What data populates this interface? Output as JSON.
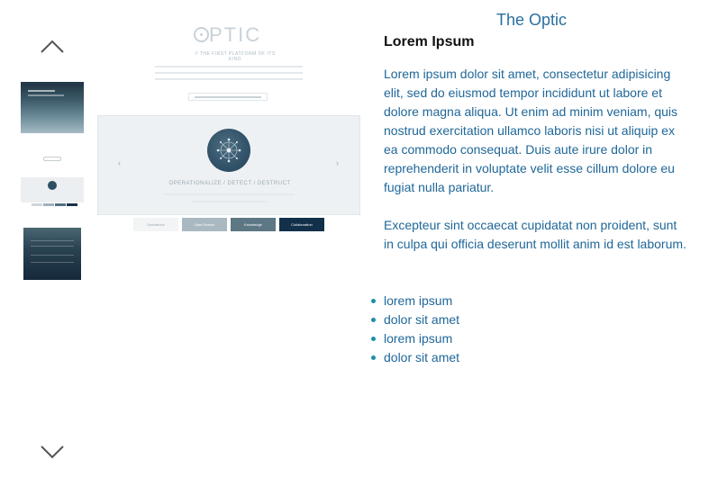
{
  "preview": {
    "logo_text": "PTIC",
    "tagline": "// THE FIRST PLATFORM OF ITS KIND",
    "panel_title": "OPERATIONALIZE / DETECT / DESTRUCT",
    "tabs": [
      {
        "label": "Operations",
        "color": "#f2f4f5"
      },
      {
        "label": "Data Search",
        "color": "#a9b8c1"
      },
      {
        "label": "Knowledge",
        "color": "#5d7785"
      },
      {
        "label": "Collaboration",
        "color": "#12304a"
      }
    ]
  },
  "content": {
    "title": "The Optic",
    "heading": "Lorem Ipsum",
    "paragraph1": "Lorem ipsum dolor sit amet, consectetur adipisicing elit, sed do eiusmod tempor incididunt ut labore et dolore magna aliqua. Ut enim ad minim veniam, quis nostrud exercitation ullamco laboris nisi ut aliquip ex ea commodo consequat. Duis aute irure dolor in reprehenderit in voluptate velit esse cillum dolore eu fugiat nulla pariatur.",
    "paragraph2": "Excepteur sint occaecat cupidatat non proident, sunt in culpa qui officia deserunt mollit anim id est laborum.",
    "bullets": [
      "lorem ipsum",
      "dolor sit amet",
      "lorem ipsum",
      "dolor sit amet"
    ]
  },
  "icons": {
    "up": "chevron-up-icon",
    "down": "chevron-down-icon"
  },
  "colors": {
    "title": "#2a6f9f",
    "text": "#1f6798",
    "bullet": "#1b8fa8"
  }
}
